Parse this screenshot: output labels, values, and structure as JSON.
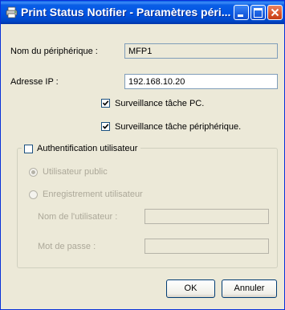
{
  "window": {
    "title": "Print Status Notifier - Paramètres péri..."
  },
  "device": {
    "name_label": "Nom du périphérique :",
    "name_value": "MFP1",
    "ip_label": "Adresse IP :",
    "ip_value": "192.168.10.20"
  },
  "monitoring": {
    "pc_task_label": "Surveillance tâche PC.",
    "pc_task_checked": true,
    "device_task_label": "Surveillance tâche périphérique.",
    "device_task_checked": true
  },
  "auth": {
    "group_label": "Authentification utilisateur",
    "checked": false,
    "public_user_label": "Utilisateur public",
    "registration_label": "Enregistrement utilisateur",
    "selected": "public",
    "username_label": "Nom de l'utilisateur :",
    "username_value": "",
    "password_label": "Mot de passe :",
    "password_value": ""
  },
  "buttons": {
    "ok": "OK",
    "cancel": "Annuler"
  }
}
